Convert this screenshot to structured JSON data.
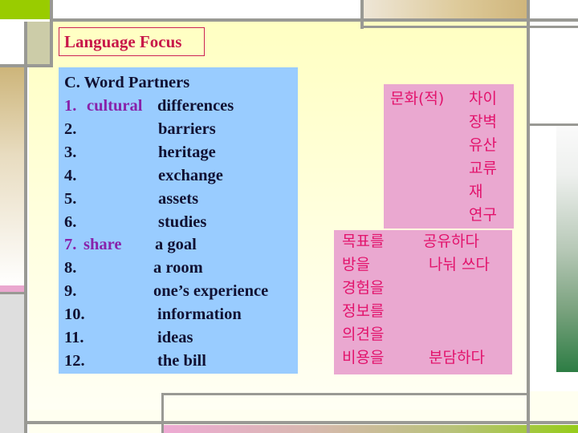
{
  "slide": {
    "title": "Language Focus",
    "section_heading": "C. Word Partners",
    "word_partners": [
      {
        "num": "1.",
        "verb": "cultural",
        "noun": "differences"
      },
      {
        "num": "2.",
        "verb": "",
        "noun": "barriers"
      },
      {
        "num": "3.",
        "verb": "",
        "noun": "heritage"
      },
      {
        "num": "4.",
        "verb": "",
        "noun": "exchange"
      },
      {
        "num": "5.",
        "verb": "",
        "noun": "assets"
      },
      {
        "num": "6.",
        "verb": "",
        "noun": "studies"
      },
      {
        "num": "7.",
        "verb": "share",
        "noun": "a goal"
      },
      {
        "num": "8.",
        "verb": "",
        "noun": "a room"
      },
      {
        "num": "9.",
        "verb": "",
        "noun": "one’s experience"
      },
      {
        "num": "10.",
        "verb": "",
        "noun": "information"
      },
      {
        "num": "11.",
        "verb": "",
        "noun": "ideas"
      },
      {
        "num": "12.",
        "verb": "",
        "noun": "the bill"
      }
    ],
    "korean_culture": {
      "header": "문화(적)",
      "items": [
        "차이",
        "장벽",
        "유산",
        "교류",
        "재",
        "연구"
      ]
    },
    "korean_share": {
      "objects": [
        "목표를",
        "방을",
        "경험을",
        "정보를",
        "의견을",
        "비용을"
      ],
      "verbs": [
        "공유하다",
        "나눠 쓰다",
        "",
        "",
        "",
        "분담하다"
      ]
    },
    "colors": {
      "title": "#c8184a",
      "highlight_word": "#8822aa",
      "word_box": "#99ccff",
      "korean_box": "#eaa8d0",
      "korean_text": "#e2136c"
    }
  }
}
